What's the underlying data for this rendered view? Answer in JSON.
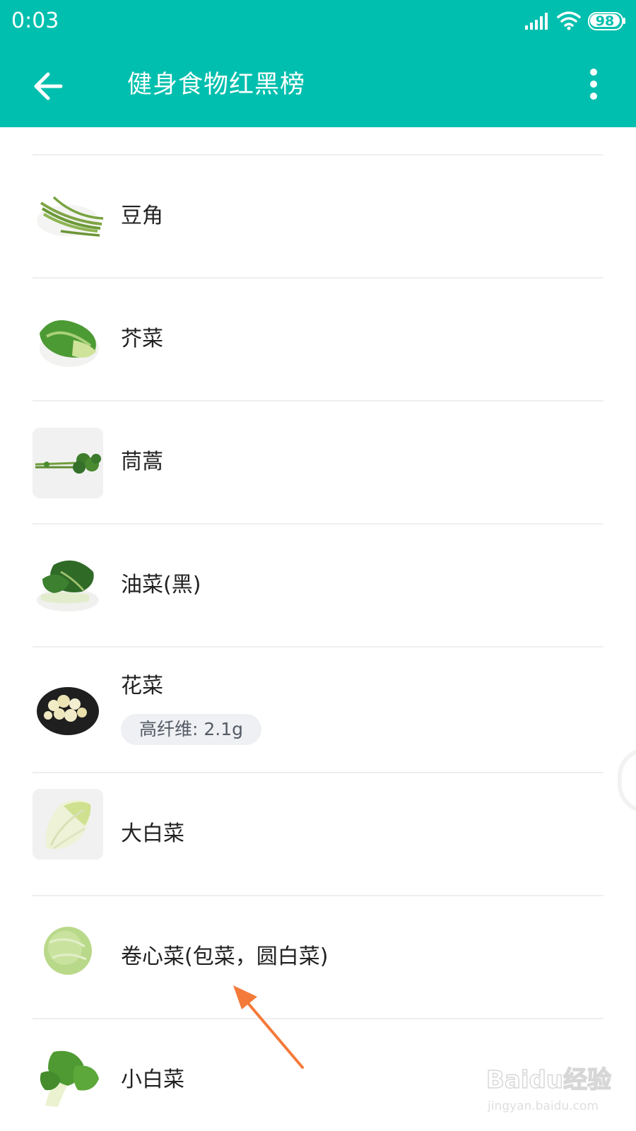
{
  "status_bar": {
    "time": "0:03",
    "battery": "98",
    "icons": [
      "signal-icon",
      "wifi-icon",
      "battery-icon"
    ]
  },
  "toolbar": {
    "title": "健身食物红黑榜",
    "back_icon": "arrow-left-icon",
    "more_icon": "more-vertical-icon"
  },
  "foods": [
    {
      "name": "豆角",
      "image": "green-beans"
    },
    {
      "name": "芥菜",
      "image": "mustard-greens"
    },
    {
      "name": "茼蒿",
      "image": "crown-daisy"
    },
    {
      "name": "油菜(黑)",
      "image": "bok-choy-dark"
    },
    {
      "name": "花菜",
      "image": "cauliflower",
      "tag": "高纤维: 2.1g"
    },
    {
      "name": "大白菜",
      "image": "napa-cabbage"
    },
    {
      "name": "卷心菜(包菜，圆白菜)",
      "image": "round-cabbage"
    },
    {
      "name": "小白菜",
      "image": "pak-choi"
    }
  ],
  "colors": {
    "accent": "#00bfae",
    "annotation_arrow": "#f47a3a",
    "divider": "#eeeeee",
    "tag_background": "#eff0f3"
  },
  "watermark": {
    "logo": "Baidu经验",
    "url": "jingyan.baidu.com"
  }
}
